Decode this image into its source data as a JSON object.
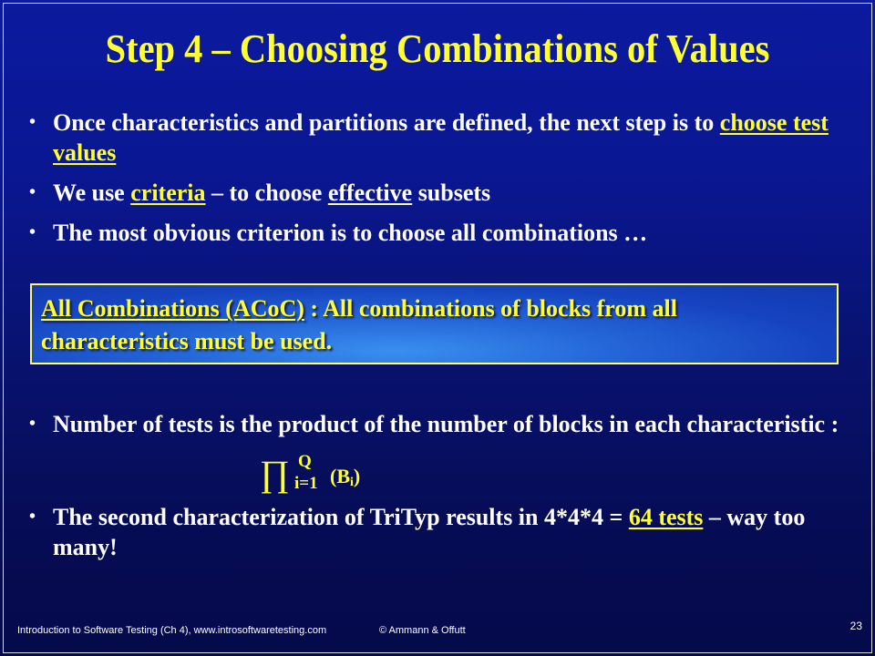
{
  "slide": {
    "title": "Step 4 – Choosing Combinations of Values",
    "bullets": [
      {
        "parts": [
          {
            "text": "Once characteristics and partitions are defined, the next step is to ",
            "style": "plain"
          },
          {
            "text": "choose test values",
            "style": "yellow-underline"
          }
        ]
      },
      {
        "parts": [
          {
            "text": "We use ",
            "style": "plain"
          },
          {
            "text": "criteria",
            "style": "yellow-underline"
          },
          {
            "text": " – to choose ",
            "style": "plain"
          },
          {
            "text": "effective",
            "style": "white-underline"
          },
          {
            "text": " subsets",
            "style": "plain"
          }
        ]
      },
      {
        "parts": [
          {
            "text": "The most obvious criterion is to choose all combinations …",
            "style": "plain"
          }
        ]
      }
    ],
    "definition_box": {
      "term": "All Combinations (ACoC)",
      "separator": " : ",
      "definition": "All combinations of blocks from all characteristics must be used."
    },
    "bullets_lower": [
      {
        "text": "Number of  tests is the product of the number of blocks in each characteristic :"
      },
      {
        "parts": [
          {
            "text": "The second characterization of TriTyp results in 4*4*4 = ",
            "style": "plain"
          },
          {
            "text": "64 tests",
            "style": "yellow-underline"
          },
          {
            "text": " – way too many!",
            "style": "plain"
          }
        ]
      }
    ],
    "formula": {
      "operator": "∏",
      "upper": "Q",
      "lower": "i=1",
      "body": "(B",
      "body_sub": "i",
      "body_close": ")"
    },
    "bullet_icon": "•",
    "colors": {
      "title": "#ffff33",
      "text": "#ffffff",
      "highlight": "#ffff33",
      "box_border": "#ffff66"
    }
  },
  "footer": {
    "left": "Introduction to Software Testing  (Ch 4), www.introsoftwaretesting.com",
    "center": "© Ammann & Offutt",
    "page_number": "23"
  }
}
